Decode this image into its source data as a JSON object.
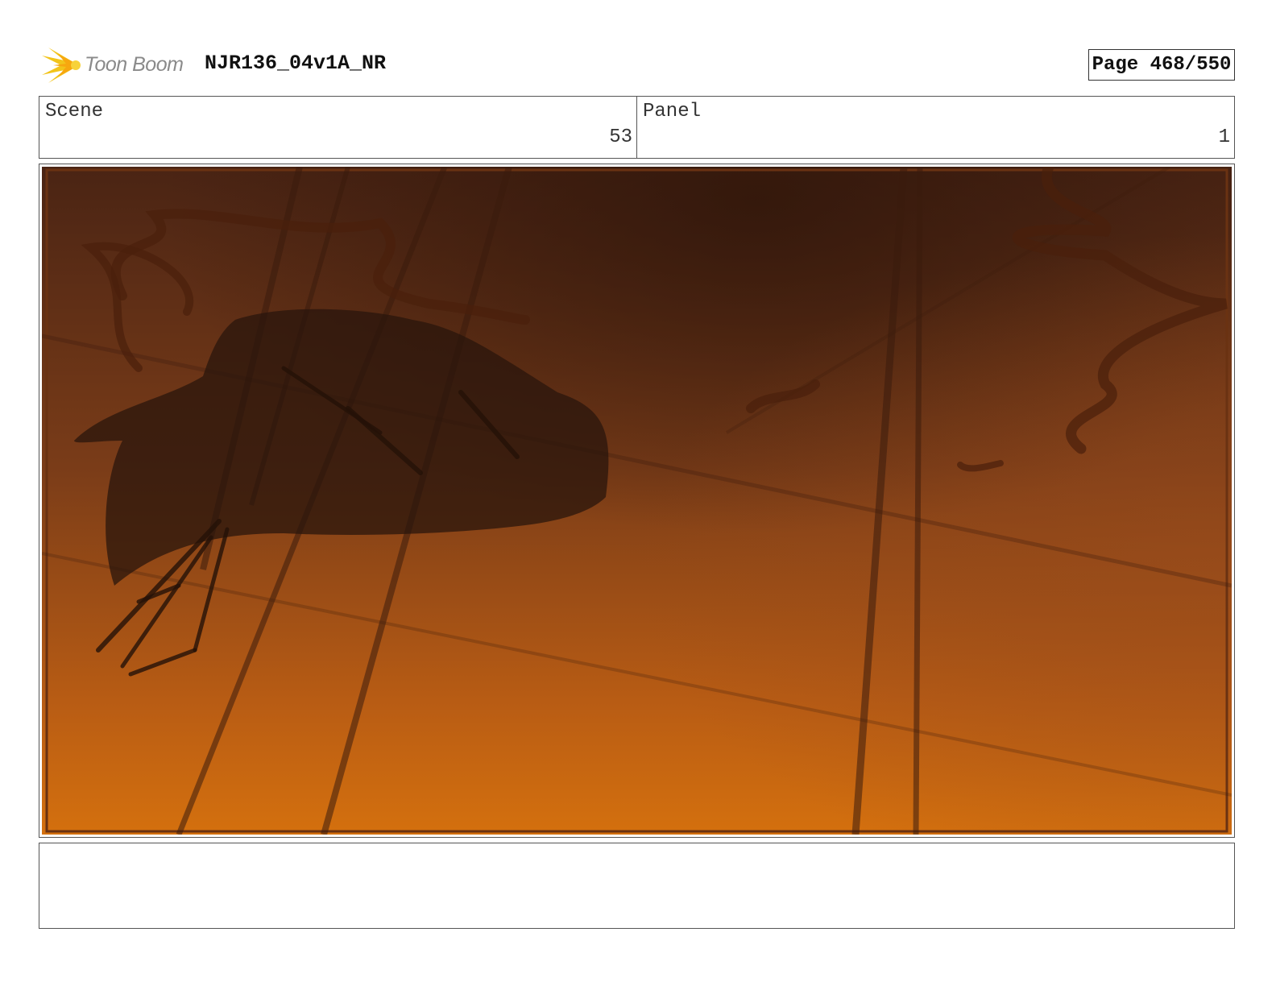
{
  "header": {
    "logo_text": "Toon Boom",
    "project_title": "NJR136_04v1A_NR",
    "page_label": "Page 468/550"
  },
  "info": {
    "scene_label": "Scene",
    "scene_value": "53",
    "panel_label": "Panel",
    "panel_value": "1"
  },
  "panel_art": {
    "description_colors": {
      "sky_top": "#4a2414",
      "sky_mid": "#7a3c18",
      "sky_bottom": "#d4700e",
      "silhouette": "#2a150c"
    }
  },
  "notes": {
    "text": ""
  }
}
